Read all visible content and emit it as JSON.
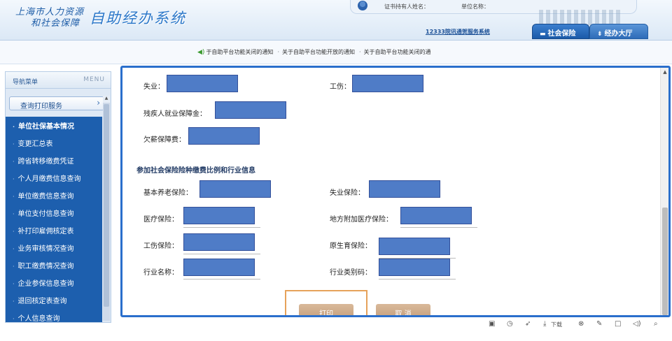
{
  "header": {
    "logo_line1": "上海市人力资源",
    "logo_line2": "和社会保障",
    "logo_title": "自助经办系统",
    "certificate_holder_label": "证书持有人姓名：",
    "unit_name_label": "单位名称：",
    "service_link": "12333院讯通贺服务系统",
    "tab_social": "社会保险",
    "tab_hall": "经办大厅"
  },
  "notices": [
    "于自助平台功能关闭的通知",
    "关于自助平台功能开放的通知",
    "关于自助平台功能关闭的通"
  ],
  "sidebar": {
    "title": "导航菜单",
    "menu_en": "MENU",
    "section": "查询打印服务",
    "items": [
      "单位社保基本情况",
      "变更汇总表",
      "跨省转移缴费凭证",
      "个人月缴费信息查询",
      "单位缴费信息查询",
      "单位支付信息查询",
      "补打印雇佣核定表",
      "业务审核情况查询",
      "职工缴费情况查询",
      "企业参保信息查询",
      "退回核定表查询",
      "个人信息查询"
    ]
  },
  "form": {
    "fields_top": [
      {
        "label": "失业："
      },
      {
        "label": "工伤："
      },
      {
        "label": "残疾人就业保障金："
      },
      {
        "label": "欠薪保障费："
      }
    ],
    "section_title": "参加社会保险险种缴费比例和行业信息",
    "fields_bottom": [
      {
        "label": "基本养老保险："
      },
      {
        "label": "失业保险："
      },
      {
        "label": "医疗保险："
      },
      {
        "label": "地方附加医疗保险："
      },
      {
        "label": "工伤保险："
      },
      {
        "label": "原生育保险："
      },
      {
        "label": "行业名称："
      },
      {
        "label": "行业类别码："
      }
    ],
    "redaction_color": "#4f7cc7"
  },
  "buttons": {
    "print": "打印",
    "cancel": "取 消"
  },
  "toolbar": {
    "download_label": "下载"
  }
}
